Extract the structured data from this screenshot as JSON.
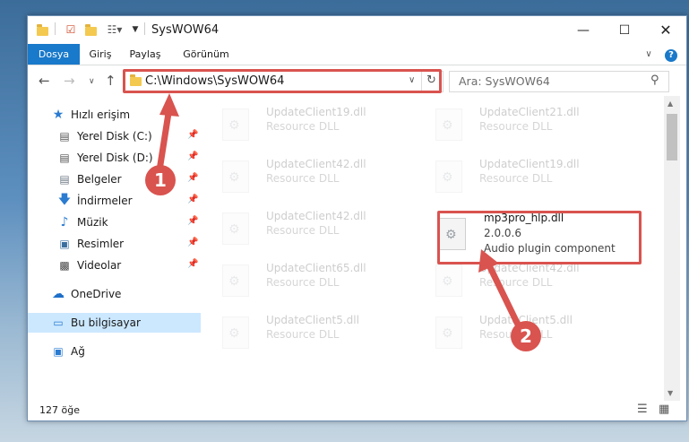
{
  "window": {
    "title": "SysWOW64"
  },
  "ribbon": {
    "tabs": [
      "Dosya",
      "Giriş",
      "Paylaş",
      "Görünüm"
    ]
  },
  "address": {
    "path": "C:\\Windows\\SysWOW64"
  },
  "search": {
    "placeholder": "Ara: SysWOW64"
  },
  "sidebar": {
    "quick_access": "Hızlı erişim",
    "items": [
      "Yerel Disk (C:)",
      "Yerel Disk (D:)",
      "Belgeler",
      "İndirmeler",
      "Müzik",
      "Resimler",
      "Videolar"
    ],
    "onedrive": "OneDrive",
    "this_pc": "Bu bilgisayar",
    "network": "Ağ"
  },
  "files": [
    {
      "name": "UpdateClient19.dll",
      "sub": "Resource DLL"
    },
    {
      "name": "UpdateClient21.dll",
      "sub": "Resource DLL"
    },
    {
      "name": "UpdateClient42.dll",
      "sub": "Resource DLL"
    },
    {
      "name": "UpdateClient19.dll",
      "sub": "Resource DLL"
    },
    {
      "name": "UpdateClient42.dll",
      "sub": "Resource DLL"
    },
    {
      "name": "mp3pro_hlp.dll",
      "version": "2.0.0.6",
      "desc": "Audio plugin component"
    },
    {
      "name": "UpdateClient65.dll",
      "sub": "Resource DLL"
    },
    {
      "name": "UpdateClient42.dll",
      "sub": "Resource DLL"
    },
    {
      "name": "UpdateClient5.dll",
      "sub": "Resource DLL"
    },
    {
      "name": "UpdateClient5.dll",
      "sub": "Resource DLL"
    }
  ],
  "status": {
    "count": "127 öğe"
  },
  "annotations": {
    "step1": "1",
    "step2": "2",
    "color": "#d9534f"
  }
}
